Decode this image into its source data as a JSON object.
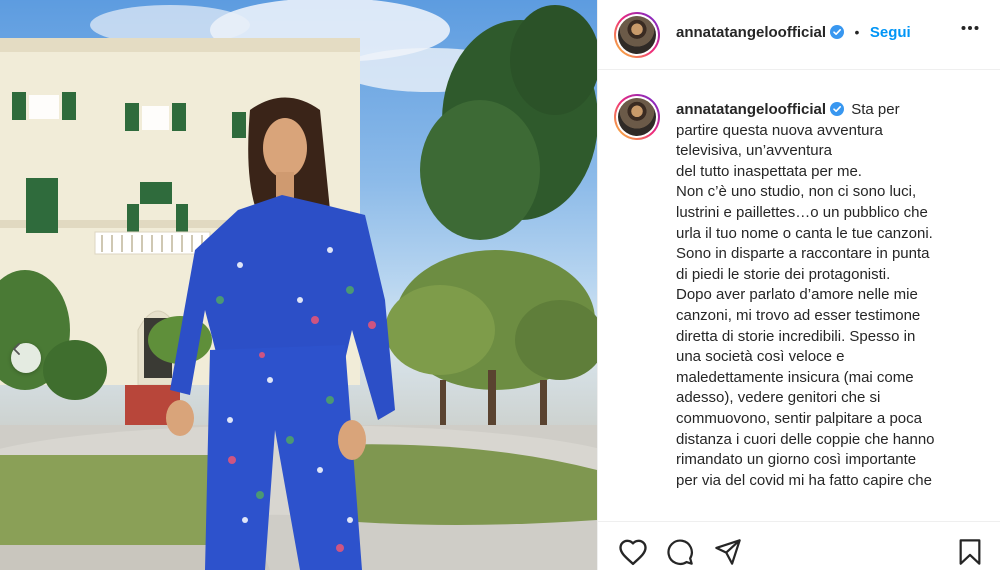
{
  "post": {
    "username": "annatatangeloofficial",
    "follow_label": "Segui",
    "separator": "•",
    "caption_lines": [
      "Sta per",
      "partire questa nuova avventura",
      "televisiva, un’avventura",
      "del tutto inaspettata per me.",
      "Non c’è uno studio, non ci sono luci,",
      "lustrini e paillettes…o un pubblico che",
      "urla il tuo nome o canta le tue canzoni.",
      "Sono in disparte a raccontare in punta",
      "di piedi le storie dei protagonisti.",
      "Dopo aver parlato d’amore nelle mie",
      "canzoni, mi trovo ad esser testimone",
      "diretta di storie incredibili. Spesso in",
      "una società così veloce e",
      "maledettamente insicura (mai come",
      "adesso), vedere genitori che si",
      "commuovono, sentir palpitare a poca",
      "distanza i cuori delle coppie che hanno",
      "rimandato un giorno così importante",
      "per via del covid mi ha fatto capire che"
    ]
  },
  "icons": {
    "verified": "verified-badge-icon",
    "more": "more-options-icon",
    "prev": "chevron-left-icon",
    "like": "heart-icon",
    "comment": "comment-bubble-icon",
    "share": "paper-plane-icon",
    "save": "bookmark-icon"
  },
  "colors": {
    "accent": "#0095f6",
    "text": "#262626",
    "border": "#efefef"
  }
}
